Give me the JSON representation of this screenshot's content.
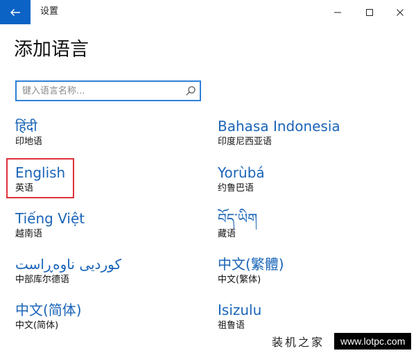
{
  "window": {
    "title": "设置"
  },
  "page": {
    "title": "添加语言"
  },
  "search": {
    "placeholder": "键入语言名称..."
  },
  "languages": [
    {
      "native": "हिंदी",
      "chinese": "印地语"
    },
    {
      "native": "Bahasa Indonesia",
      "chinese": "印度尼西亚语"
    },
    {
      "native": "English",
      "chinese": "英语"
    },
    {
      "native": "Yorùbá",
      "chinese": "约鲁巴语"
    },
    {
      "native": "Tiếng Việt",
      "chinese": "越南语"
    },
    {
      "native": "བོད་ཡིག",
      "chinese": "藏语"
    },
    {
      "native": "کوردیی ناوەڕاست",
      "chinese": "中部库尔德语"
    },
    {
      "native": "中文(繁體)",
      "chinese": "中文(繁体)"
    },
    {
      "native": "中文(简体)",
      "chinese": "中文(简体)"
    },
    {
      "native": "Isizulu",
      "chinese": "祖鲁语"
    }
  ],
  "watermark": {
    "text": "装机之家",
    "url": "www.lotpc.com"
  },
  "colors": {
    "accent": "#0b63c5",
    "link": "#1a64b8",
    "highlight": "#e0313b"
  }
}
